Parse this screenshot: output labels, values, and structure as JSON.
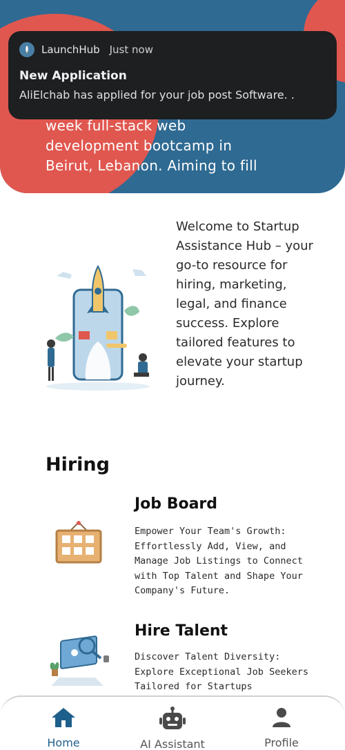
{
  "hero": {
    "text": "week full-stack web development bootcamp in Beirut, Lebanon. Aiming to fill"
  },
  "notification": {
    "app_icon": "rocket-icon",
    "app_name": "LaunchHub",
    "time": "Just now",
    "title": "New Application",
    "body": "AliElchab has applied for your job post Software. ."
  },
  "welcome": {
    "text": "Welcome to Startup Assistance Hub – your go-to resource for hiring, marketing, legal, and finance success. Explore tailored features to elevate your startup journey."
  },
  "sections": {
    "hiring_title": "Hiring"
  },
  "cards": {
    "job_board": {
      "title": "Job Board",
      "description": "Empower Your Team's Growth: Effortlessly Add, View, and Manage Job Listings to Connect with Top Talent and Shape Your Company's Future."
    },
    "hire_talent": {
      "title": "Hire Talent",
      "description": "Discover Talent Diversity: Explore Exceptional Job Seekers Tailored for Startups"
    }
  },
  "nav": {
    "items": [
      {
        "label": "Home",
        "icon": "home-icon",
        "active": true
      },
      {
        "label": "AI Assistant",
        "icon": "robot-icon",
        "active": false
      },
      {
        "label": "Profile",
        "icon": "person-icon",
        "active": false
      }
    ]
  },
  "colors": {
    "primary": "#2f6a92",
    "accent": "#e0574f",
    "nav_active": "#1f5f8b"
  }
}
